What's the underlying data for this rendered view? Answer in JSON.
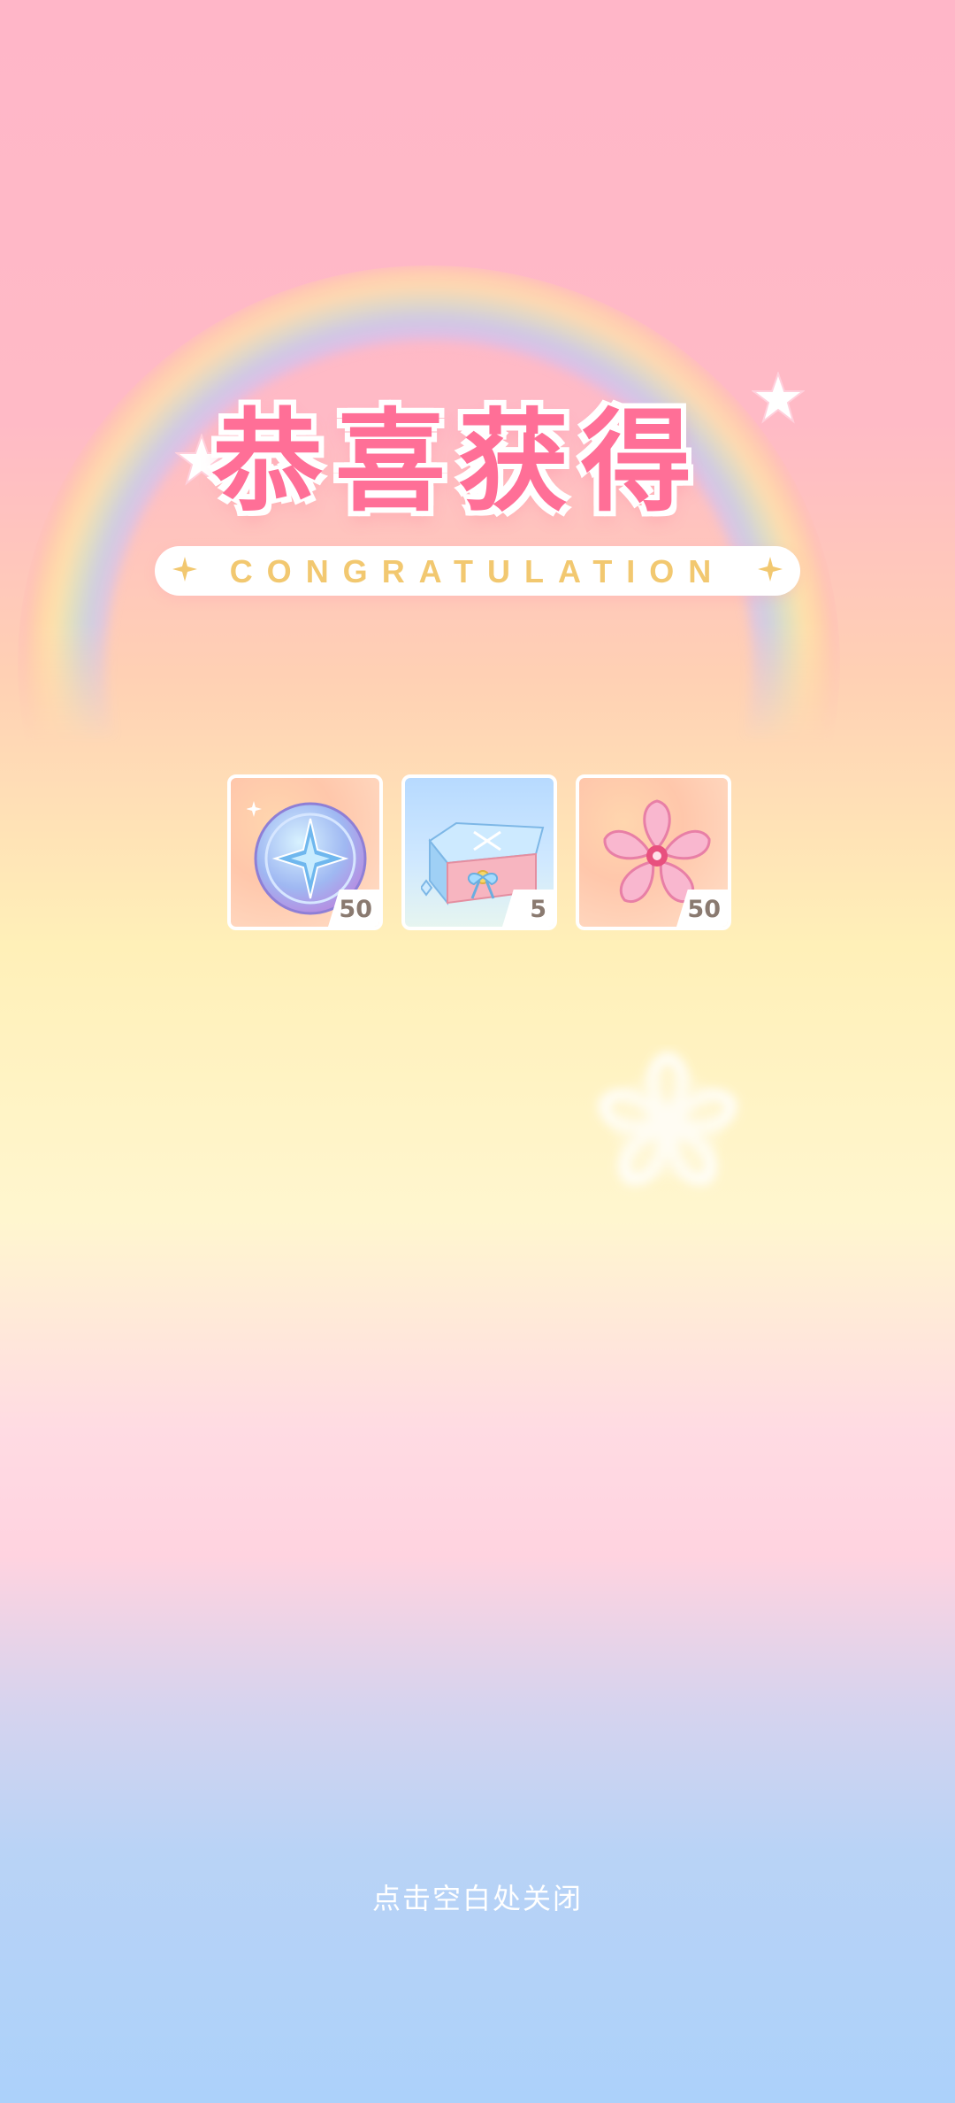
{
  "title": {
    "main": "恭喜获得",
    "subtitle": "CONGRATULATION"
  },
  "items": [
    {
      "icon": "star-coin-icon",
      "count": "50"
    },
    {
      "icon": "gift-box-icon",
      "count": "5"
    },
    {
      "icon": "sakura-flower-icon",
      "count": "50"
    }
  ],
  "hint": {
    "close_text": "点击空白处关闭"
  },
  "colors": {
    "title": "#ff6f97",
    "subtitle": "#f2c870",
    "count": "#8a7a70"
  }
}
